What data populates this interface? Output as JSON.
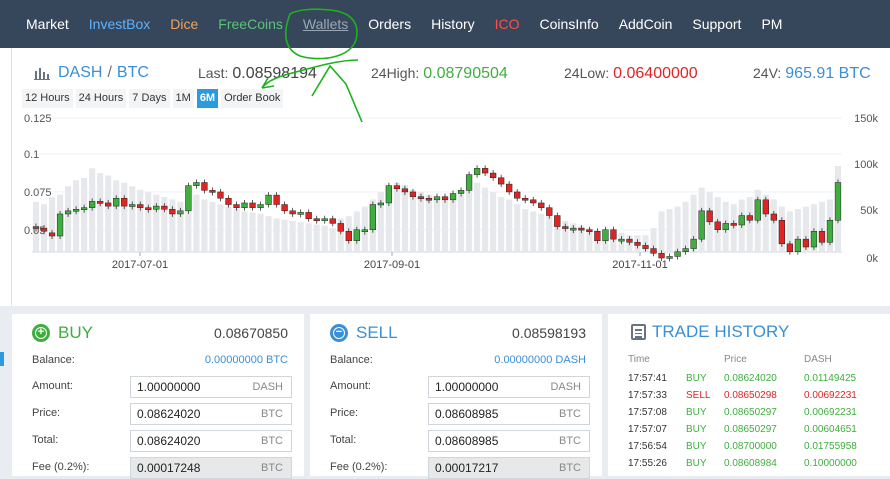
{
  "nav": {
    "items": [
      {
        "label": "Market",
        "color": "#ffffff"
      },
      {
        "label": "InvestBox",
        "color": "#5db2ff"
      },
      {
        "label": "Dice",
        "color": "#f0a35a"
      },
      {
        "label": "FreeCoins",
        "color": "#5bc27a"
      },
      {
        "label": "Wallets",
        "color": "#9aa7b6"
      },
      {
        "label": "Orders",
        "color": "#ffffff"
      },
      {
        "label": "History",
        "color": "#ffffff"
      },
      {
        "label": "ICO",
        "color": "#ff4d4d"
      },
      {
        "label": "CoinsInfo",
        "color": "#ffffff"
      },
      {
        "label": "AddCoin",
        "color": "#ffffff"
      },
      {
        "label": "Support",
        "color": "#ffffff"
      },
      {
        "label": "PM",
        "color": "#ffffff"
      }
    ]
  },
  "market": {
    "base": "DASH",
    "sep": "/",
    "quote": "BTC",
    "last_label": "Last:",
    "last_value": "0.08598194",
    "high_label": "24High:",
    "high_value": "0.08790504",
    "low_label": "24Low:",
    "low_value": "0.06400000",
    "vol_label": "24V:",
    "vol_value": "965.91 BTC",
    "ranges": [
      "12 Hours",
      "24 Hours",
      "7 Days",
      "1M",
      "6M",
      "Order Book"
    ],
    "active_range": "6M",
    "colors": {
      "up": "#3fae3f",
      "down": "#e02424",
      "accent": "#3a8fd6"
    }
  },
  "chart_data": {
    "type": "candlestick",
    "y_ticks": [
      "0.125",
      "0.1",
      "0.075",
      "0.05"
    ],
    "y_range": [
      0.05,
      0.125
    ],
    "vol_ticks": [
      "150k",
      "100k",
      "50k",
      "0k"
    ],
    "vol_range": [
      0,
      150
    ],
    "x_ticks": [
      "2017-07-01",
      "2017-09-01",
      "2017-11-01"
    ],
    "candles": [
      [
        0.056,
        0.055,
        42
      ],
      [
        0.055,
        0.053,
        40
      ],
      [
        0.052,
        0.05,
        46
      ],
      [
        0.05,
        0.064,
        48
      ],
      [
        0.064,
        0.066,
        55
      ],
      [
        0.066,
        0.067,
        60
      ],
      [
        0.067,
        0.068,
        62
      ],
      [
        0.068,
        0.072,
        70
      ],
      [
        0.072,
        0.071,
        66
      ],
      [
        0.071,
        0.069,
        64
      ],
      [
        0.069,
        0.074,
        60
      ],
      [
        0.074,
        0.069,
        58
      ],
      [
        0.069,
        0.07,
        55
      ],
      [
        0.07,
        0.068,
        52
      ],
      [
        0.068,
        0.067,
        50
      ],
      [
        0.067,
        0.069,
        48
      ],
      [
        0.069,
        0.067,
        46
      ],
      [
        0.067,
        0.064,
        44
      ],
      [
        0.064,
        0.066,
        42
      ],
      [
        0.066,
        0.082,
        46
      ],
      [
        0.082,
        0.084,
        48
      ],
      [
        0.084,
        0.079,
        44
      ],
      [
        0.079,
        0.078,
        42
      ],
      [
        0.078,
        0.074,
        40
      ],
      [
        0.074,
        0.07,
        38
      ],
      [
        0.07,
        0.068,
        36
      ],
      [
        0.068,
        0.071,
        34
      ],
      [
        0.071,
        0.068,
        33
      ],
      [
        0.068,
        0.07,
        32
      ],
      [
        0.07,
        0.076,
        30
      ],
      [
        0.076,
        0.07,
        28
      ],
      [
        0.07,
        0.066,
        27
      ],
      [
        0.066,
        0.064,
        26
      ],
      [
        0.064,
        0.065,
        25
      ],
      [
        0.065,
        0.061,
        24
      ],
      [
        0.061,
        0.06,
        23
      ],
      [
        0.06,
        0.061,
        22
      ],
      [
        0.061,
        0.058,
        20
      ],
      [
        0.058,
        0.053,
        28
      ],
      [
        0.053,
        0.047,
        30
      ],
      [
        0.047,
        0.054,
        34
      ],
      [
        0.054,
        0.054,
        38
      ],
      [
        0.054,
        0.07,
        44
      ],
      [
        0.07,
        0.071,
        50
      ],
      [
        0.071,
        0.082,
        56
      ],
      [
        0.082,
        0.08,
        58
      ],
      [
        0.08,
        0.078,
        56
      ],
      [
        0.078,
        0.075,
        52
      ],
      [
        0.075,
        0.074,
        50
      ],
      [
        0.074,
        0.073,
        48
      ],
      [
        0.073,
        0.075,
        46
      ],
      [
        0.075,
        0.073,
        44
      ],
      [
        0.073,
        0.077,
        46
      ],
      [
        0.077,
        0.079,
        48
      ],
      [
        0.079,
        0.089,
        54
      ],
      [
        0.089,
        0.093,
        58
      ],
      [
        0.093,
        0.09,
        54
      ],
      [
        0.09,
        0.087,
        50
      ],
      [
        0.087,
        0.083,
        46
      ],
      [
        0.083,
        0.078,
        44
      ],
      [
        0.078,
        0.074,
        40
      ],
      [
        0.074,
        0.073,
        36
      ],
      [
        0.073,
        0.071,
        34
      ],
      [
        0.071,
        0.068,
        32
      ],
      [
        0.068,
        0.063,
        30
      ],
      [
        0.063,
        0.056,
        28
      ],
      [
        0.056,
        0.055,
        26
      ],
      [
        0.055,
        0.055,
        24
      ],
      [
        0.055,
        0.054,
        22
      ],
      [
        0.054,
        0.053,
        20
      ],
      [
        0.053,
        0.047,
        18
      ],
      [
        0.047,
        0.054,
        16
      ],
      [
        0.054,
        0.048,
        18
      ],
      [
        0.048,
        0.048,
        16
      ],
      [
        0.048,
        0.046,
        14
      ],
      [
        0.046,
        0.044,
        14
      ],
      [
        0.044,
        0.042,
        14
      ],
      [
        0.042,
        0.039,
        20
      ],
      [
        0.039,
        0.036,
        34
      ],
      [
        0.036,
        0.037,
        36
      ],
      [
        0.037,
        0.04,
        38
      ],
      [
        0.04,
        0.042,
        42
      ],
      [
        0.042,
        0.048,
        48
      ],
      [
        0.048,
        0.066,
        54
      ],
      [
        0.066,
        0.059,
        50
      ],
      [
        0.059,
        0.054,
        46
      ],
      [
        0.054,
        0.058,
        42
      ],
      [
        0.058,
        0.057,
        40
      ],
      [
        0.057,
        0.063,
        44
      ],
      [
        0.063,
        0.06,
        46
      ],
      [
        0.06,
        0.073,
        52
      ],
      [
        0.073,
        0.064,
        48
      ],
      [
        0.064,
        0.06,
        44
      ],
      [
        0.06,
        0.045,
        38
      ],
      [
        0.045,
        0.04,
        34
      ],
      [
        0.04,
        0.048,
        36
      ],
      [
        0.048,
        0.043,
        38
      ],
      [
        0.043,
        0.053,
        40
      ],
      [
        0.053,
        0.046,
        42
      ],
      [
        0.046,
        0.06,
        44
      ],
      [
        0.06,
        0.084,
        72
      ]
    ]
  },
  "buy": {
    "title": "BUY",
    "price": "0.08670850",
    "balance_label": "Balance:",
    "balance_value": "0.00000000 BTC",
    "amount_label": "Amount:",
    "amount_value": "1.00000000",
    "amount_unit": "DASH",
    "price_label": "Price:",
    "price_value": "0.08624020",
    "price_unit": "BTC",
    "total_label": "Total:",
    "total_value": "0.08624020",
    "total_unit": "BTC",
    "fee_label": "Fee (0.2%):",
    "fee_value": "0.00017248",
    "fee_unit": "BTC"
  },
  "sell": {
    "title": "SELL",
    "price": "0.08598193",
    "balance_label": "Balance:",
    "balance_value": "0.00000000 DASH",
    "amount_label": "Amount:",
    "amount_value": "1.00000000",
    "amount_unit": "DASH",
    "price_label": "Price:",
    "price_value": "0.08608985",
    "price_unit": "BTC",
    "total_label": "Total:",
    "total_value": "0.08608985",
    "total_unit": "BTC",
    "fee_label": "Fee (0.2%):",
    "fee_value": "0.00017217",
    "fee_unit": "BTC"
  },
  "trade_history": {
    "title": "TRADE HISTORY",
    "col_time": "Time",
    "col_price": "Price",
    "col_amount": "DASH",
    "rows": [
      {
        "time": "17:57:41",
        "type": "BUY",
        "price": "0.08624020",
        "amount": "0.01149425"
      },
      {
        "time": "17:57:33",
        "type": "SELL",
        "price": "0.08650298",
        "amount": "0.00692231"
      },
      {
        "time": "17:57:08",
        "type": "BUY",
        "price": "0.08650297",
        "amount": "0.00692231"
      },
      {
        "time": "17:57:07",
        "type": "BUY",
        "price": "0.08650297",
        "amount": "0.00604651"
      },
      {
        "time": "17:56:54",
        "type": "BUY",
        "price": "0.08700000",
        "amount": "0.01755958"
      },
      {
        "time": "17:55:26",
        "type": "BUY",
        "price": "0.08608984",
        "amount": "0.10000000"
      }
    ]
  }
}
